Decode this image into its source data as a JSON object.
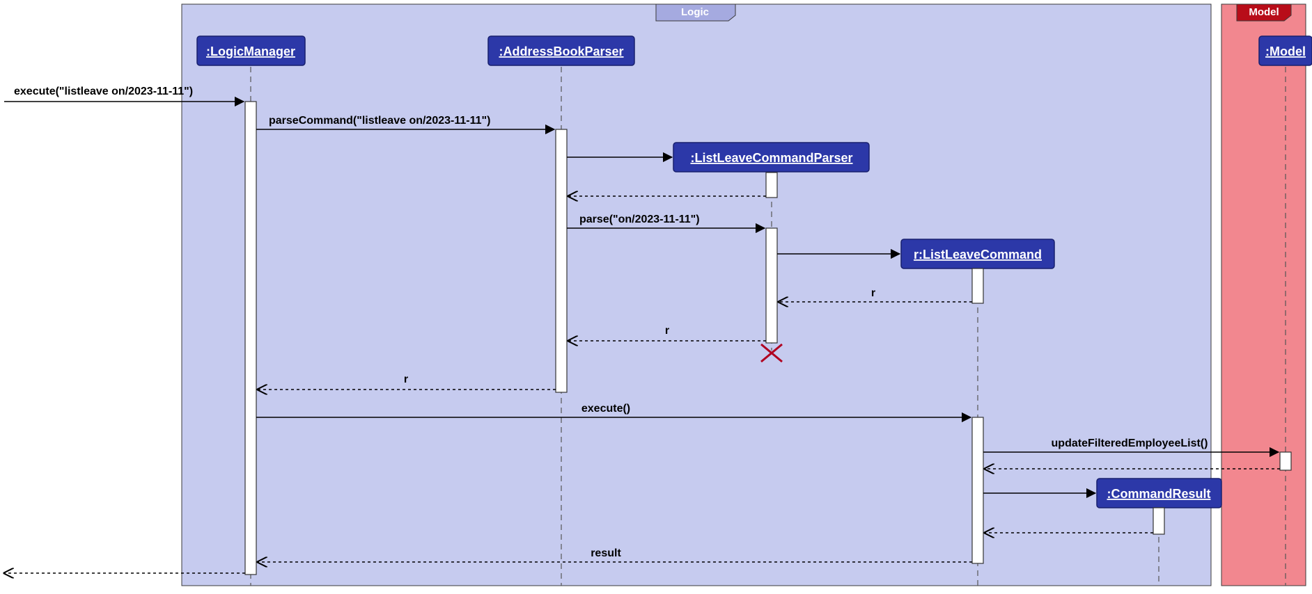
{
  "frames": {
    "logic": {
      "title": "Logic"
    },
    "model": {
      "title": "Model"
    }
  },
  "participants": {
    "logicManager": ":LogicManager",
    "addressBookParser": ":AddressBookParser",
    "listLeaveCommandParser": ":ListLeaveCommandParser",
    "listLeaveCommand": "r:ListLeaveCommand",
    "commandResult": ":CommandResult",
    "model": ":Model"
  },
  "messages": {
    "execute_in": "execute(\"listleave on/2023-11-11\")",
    "parseCommand": "parseCommand(\"listleave on/2023-11-11\")",
    "parse": "parse(\"on/2023-11-11\")",
    "r1": "r",
    "r2": "r",
    "r3": "r",
    "execute": "execute()",
    "updateFilteredEmployeeList": "updateFilteredEmployeeList()",
    "result": "result"
  },
  "chart_data": {
    "type": "sequence_diagram",
    "frames": [
      {
        "name": "Logic",
        "participants": [
          "LogicManager",
          "AddressBookParser",
          "ListLeaveCommandParser",
          "ListLeaveCommand",
          "CommandResult"
        ]
      },
      {
        "name": "Model",
        "participants": [
          "Model"
        ]
      }
    ],
    "participants": [
      {
        "id": "LogicManager",
        "label": ":LogicManager"
      },
      {
        "id": "AddressBookParser",
        "label": ":AddressBookParser"
      },
      {
        "id": "ListLeaveCommandParser",
        "label": ":ListLeaveCommandParser",
        "created_by_message": 2,
        "destroyed_after_message": 7
      },
      {
        "id": "ListLeaveCommand",
        "label": "r:ListLeaveCommand",
        "created_by_message": 4
      },
      {
        "id": "CommandResult",
        "label": ":CommandResult",
        "created_by_message": 12
      },
      {
        "id": "Model",
        "label": ":Model"
      }
    ],
    "messages": [
      {
        "n": 1,
        "from": "external",
        "to": "LogicManager",
        "label": "execute(\"listleave on/2023-11-11\")",
        "type": "sync"
      },
      {
        "n": 2,
        "from": "LogicManager",
        "to": "AddressBookParser",
        "label": "parseCommand(\"listleave on/2023-11-11\")",
        "type": "sync"
      },
      {
        "n": 3,
        "from": "AddressBookParser",
        "to": "ListLeaveCommandParser",
        "label": "",
        "type": "create"
      },
      {
        "n": 4,
        "from": "ListLeaveCommandParser",
        "to": "AddressBookParser",
        "label": "",
        "type": "return"
      },
      {
        "n": 5,
        "from": "AddressBookParser",
        "to": "ListLeaveCommandParser",
        "label": "parse(\"on/2023-11-11\")",
        "type": "sync"
      },
      {
        "n": 6,
        "from": "ListLeaveCommandParser",
        "to": "ListLeaveCommand",
        "label": "",
        "type": "create"
      },
      {
        "n": 7,
        "from": "ListLeaveCommand",
        "to": "ListLeaveCommandParser",
        "label": "r",
        "type": "return"
      },
      {
        "n": 8,
        "from": "ListLeaveCommandParser",
        "to": "AddressBookParser",
        "label": "r",
        "type": "return"
      },
      {
        "n": 9,
        "from": "AddressBookParser",
        "to": "LogicManager",
        "label": "r",
        "type": "return"
      },
      {
        "n": 10,
        "from": "LogicManager",
        "to": "ListLeaveCommand",
        "label": "execute()",
        "type": "sync"
      },
      {
        "n": 11,
        "from": "ListLeaveCommand",
        "to": "Model",
        "label": "updateFilteredEmployeeList()",
        "type": "sync"
      },
      {
        "n": 12,
        "from": "Model",
        "to": "ListLeaveCommand",
        "label": "",
        "type": "return"
      },
      {
        "n": 13,
        "from": "ListLeaveCommand",
        "to": "CommandResult",
        "label": "",
        "type": "create"
      },
      {
        "n": 14,
        "from": "CommandResult",
        "to": "ListLeaveCommand",
        "label": "",
        "type": "return"
      },
      {
        "n": 15,
        "from": "ListLeaveCommand",
        "to": "LogicManager",
        "label": "result",
        "type": "return"
      },
      {
        "n": 16,
        "from": "LogicManager",
        "to": "external",
        "label": "",
        "type": "return"
      }
    ]
  }
}
